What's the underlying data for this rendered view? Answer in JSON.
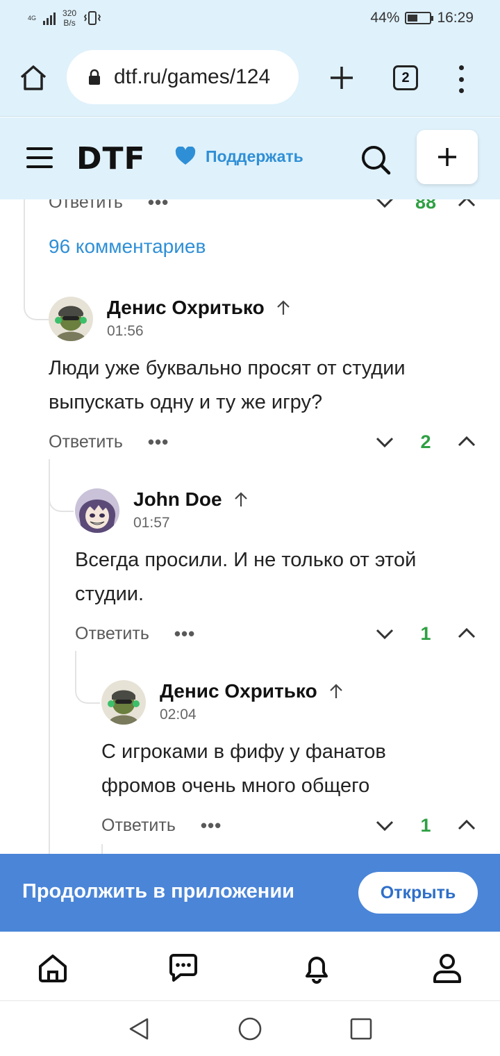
{
  "status_bar": {
    "network": "4G",
    "speed_value": "320",
    "speed_unit": "B/s",
    "battery": "44%",
    "battery_level": 0.44,
    "time": "16:29"
  },
  "browser": {
    "url": "dtf.ru/games/124",
    "tab_count": "2"
  },
  "site_header": {
    "logo": "DTF",
    "support_label": "Поддержать",
    "heart_color": "#2f8fd6"
  },
  "thread": {
    "prev_reply_label": "Ответить",
    "prev_score": "88",
    "comments_count": "96 комментариев",
    "comments": [
      {
        "author": "Денис Охритько",
        "time": "01:56",
        "text_lines": [
          "Люди уже буквально просят от студии",
          "выпускать одну и ту же игру?"
        ],
        "reply_label": "Ответить",
        "score": "2"
      },
      {
        "author": "John Doe",
        "time": "01:57",
        "text_lines": [
          "Всегда просили. И не только от этой",
          "студии."
        ],
        "reply_label": "Ответить",
        "score": "1"
      },
      {
        "author": "Денис Охритько",
        "time": "02:04",
        "text_lines": [
          "С игроками в фифу у фанатов",
          "фромов очень много общего"
        ],
        "reply_label": "Ответить",
        "score": "1"
      }
    ],
    "more_icon": "more-dots-icon",
    "score_color": "#2ea043"
  },
  "app_banner": {
    "label": "Продолжить в приложении",
    "button_label": "Открыть",
    "background": "#4a85d8"
  },
  "bottom_nav": {
    "items": [
      "home-icon",
      "comments-icon",
      "bell-icon",
      "profile-icon"
    ]
  },
  "system_nav": {
    "items": [
      "back-icon",
      "home-circle-icon",
      "recents-icon"
    ]
  },
  "colors": {
    "header_bg": "#dff1fb",
    "link_blue": "#2f8fd6"
  }
}
